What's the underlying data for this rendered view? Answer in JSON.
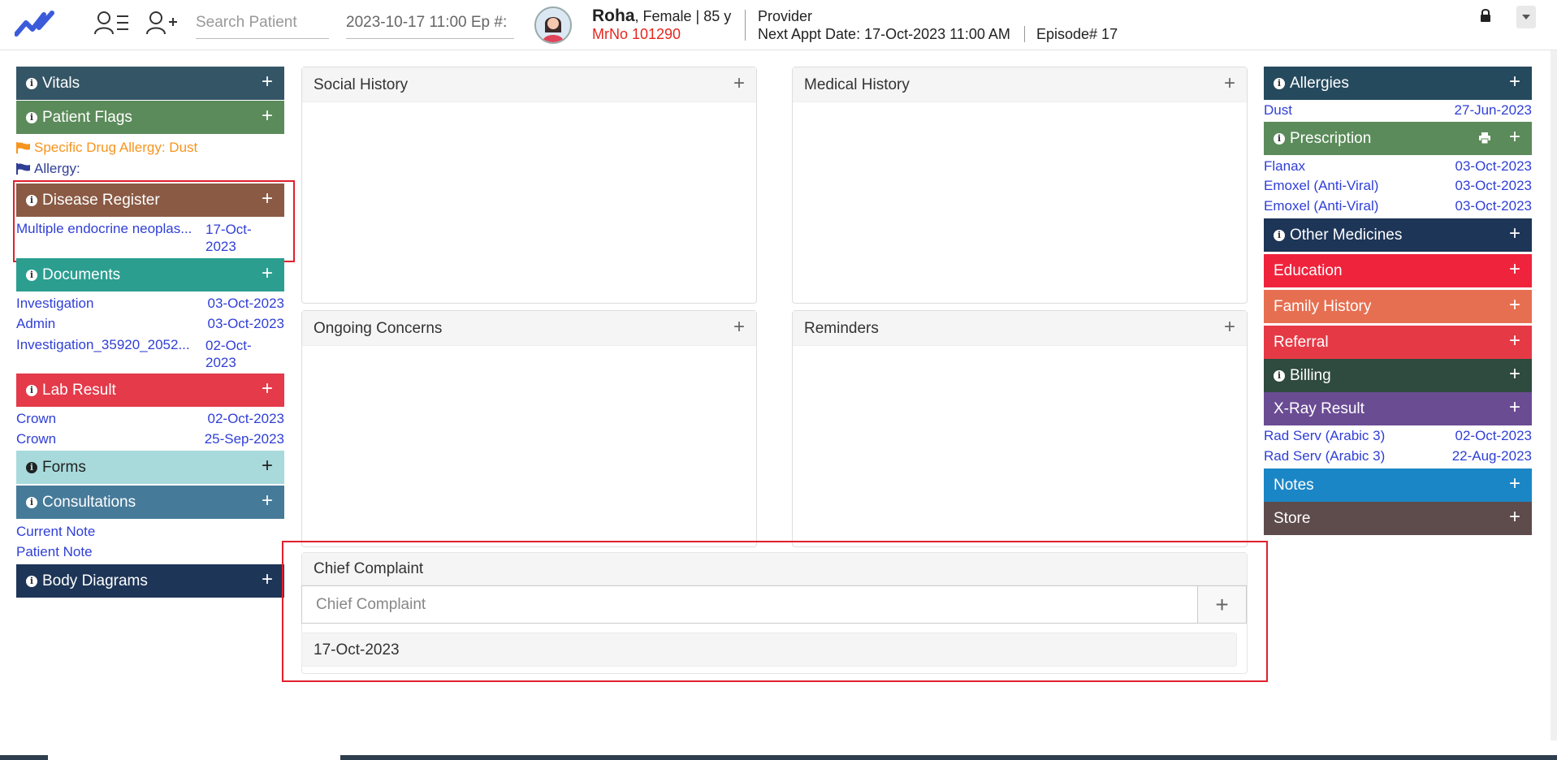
{
  "header": {
    "search_placeholder": "Search Patient",
    "episode_field": "2023-10-17 11:00 Ep #:",
    "patient_name": "Roha",
    "patient_details": ", Female | 85 y",
    "mrn": "MrNo 101290",
    "provider": "Provider",
    "next_appt_label": "Next Appt Date",
    "next_appt_value": ": 17-Oct-2023 11:00 AM",
    "episode": "Episode# 17"
  },
  "left": {
    "vitals": "Vitals",
    "patient_flags": "Patient Flags",
    "flag_1": "Specific Drug Allergy: Dust",
    "flag_2": "Allergy:",
    "disease_register": "Disease Register",
    "disease_item": {
      "name": "Multiple endocrine neoplas...",
      "date": "17-Oct-2023"
    },
    "documents": "Documents",
    "document_items": [
      {
        "name": "Investigation",
        "date": "03-Oct-2023"
      },
      {
        "name": "Admin",
        "date": "03-Oct-2023"
      },
      {
        "name": "Investigation_35920_2052...",
        "date": "02-Oct-2023"
      }
    ],
    "lab_result": "Lab Result",
    "lab_items": [
      {
        "name": "Crown",
        "date": "02-Oct-2023"
      },
      {
        "name": "Crown",
        "date": "25-Sep-2023"
      }
    ],
    "forms": "Forms",
    "consultations": "Consultations",
    "consult_items": [
      "Current Note",
      "Patient Note"
    ],
    "body_diagrams": "Body Diagrams"
  },
  "center": {
    "social_history": "Social History",
    "medical_history": "Medical History",
    "ongoing_concerns": "Ongoing Concerns",
    "reminders": "Reminders",
    "chief_complaint": "Chief Complaint",
    "cc_placeholder": "Chief Complaint",
    "cc_entry_date": "17-Oct-2023"
  },
  "right": {
    "allergies": "Allergies",
    "allergy_items": [
      {
        "name": "Dust",
        "date": "27-Jun-2023"
      }
    ],
    "prescription": "Prescription",
    "prescription_items": [
      {
        "name": "Flanax",
        "date": "03-Oct-2023"
      },
      {
        "name": "Emoxel (Anti-Viral)",
        "date": "03-Oct-2023"
      },
      {
        "name": "Emoxel (Anti-Viral)",
        "date": "03-Oct-2023"
      }
    ],
    "other_medicines": "Other Medicines",
    "education": "Education",
    "family_history": "Family History",
    "referral": "Referral",
    "billing": "Billing",
    "xray_result": "X-Ray Result",
    "xray_items": [
      {
        "name": "Rad Serv (Arabic 3)",
        "date": "02-Oct-2023"
      },
      {
        "name": "Rad Serv (Arabic 3)",
        "date": "22-Aug-2023"
      }
    ],
    "notes": "Notes",
    "store": "Store"
  },
  "colors": {
    "vitals": "#345566",
    "patient_flags": "#5b8b5a",
    "disease_register": "#8a5a44",
    "documents": "#2b9e90",
    "lab_result": "#e43a4a",
    "forms": "#a8dadc",
    "consultations": "#467a99",
    "body_diagrams": "#1d3557",
    "allergies": "#254a5e",
    "prescription": "#5b8b5a",
    "other_medicines": "#1d3557",
    "education": "#ef233c",
    "family_history": "#e76f51",
    "referral": "#e63946",
    "billing": "#2f4a3e",
    "xray_result": "#6a4c93",
    "notes": "#1b86c6",
    "store": "#5e4b4b",
    "link": "#2f3fd6",
    "flag_orange": "#f7941d",
    "flag_blue": "#2f3f96",
    "highlight": "#e0202c"
  },
  "icons": [
    "app-logo-icon",
    "patient-list-icon",
    "add-patient-icon",
    "lock-icon",
    "chevron-down-icon",
    "info-icon",
    "plus-icon",
    "print-icon",
    "flag-icon"
  ]
}
